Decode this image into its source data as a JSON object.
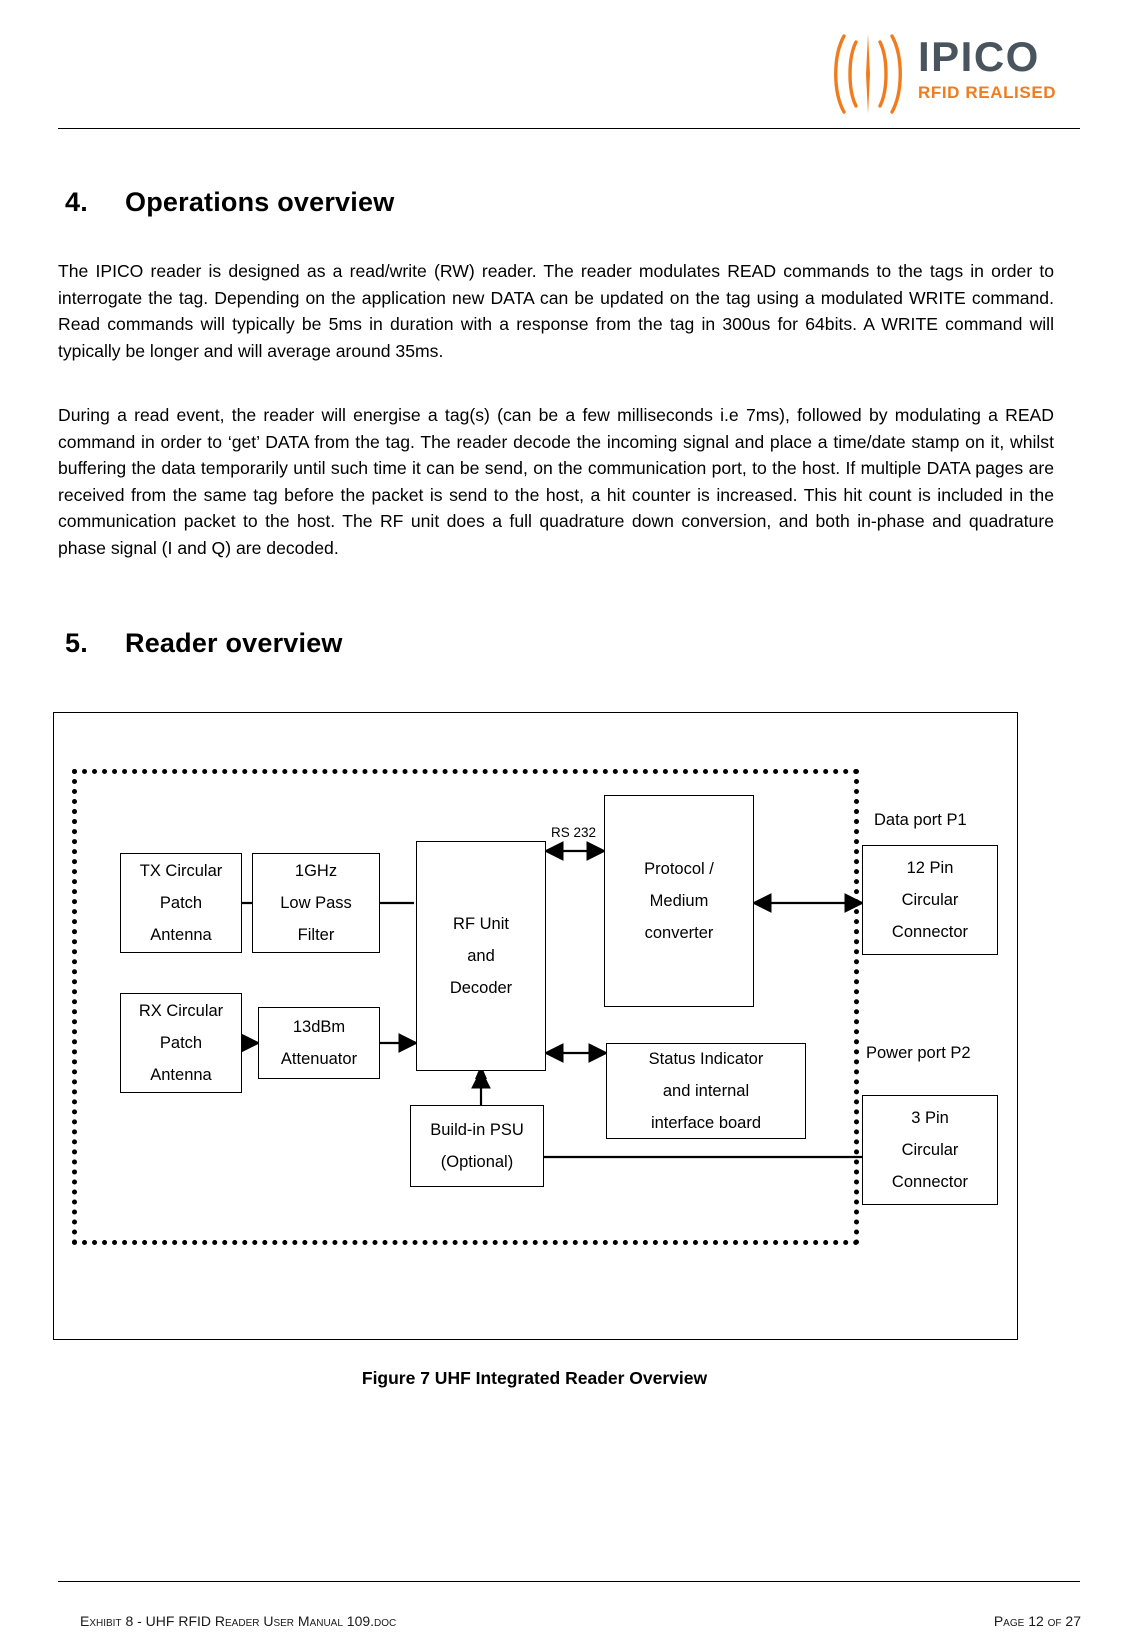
{
  "header": {
    "logo": {
      "wordmark": "IPICO",
      "tagline": "RFID REALISED",
      "mark_icon": "rfid-wave-icon",
      "wordmark_color": "#4a545e",
      "tagline_color": "#f07c1e"
    }
  },
  "sections": [
    {
      "number": "4.",
      "title": "Operations overview",
      "paragraphs": [
        "The IPICO reader is designed as a read/write (RW) reader.  The reader modulates READ commands to the tags in order to interrogate the tag. Depending on the application new DATA can be updated on the tag using a modulated WRITE command. Read commands will typically be 5ms in duration with a response from the tag in 300us for 64bits. A WRITE command will typically be longer and will average around 35ms.",
        "During a read event, the reader will energise a tag(s) (can be a few milliseconds i.e 7ms), followed by modulating a READ command in order to ‘get’ DATA from the tag. The reader  decode the incoming signal and place a time/date stamp on it, whilst buffering the data temporarily until such time it can be send, on the communication port, to the host.  If multiple DATA pages are received from the same tag before the packet is send to the host, a hit counter is increased.  This hit count is included in the communication packet to the host.  The RF unit does a full quadrature down conversion, and both in-phase and quadrature phase signal (I and Q) are decoded."
      ]
    },
    {
      "number": "5.",
      "title": "Reader overview",
      "paragraphs": []
    }
  ],
  "figure": {
    "caption": "Figure 7 UHF Integrated Reader Overview",
    "blocks": {
      "tx_antenna": [
        "TX Circular",
        "Patch",
        "Antenna"
      ],
      "low_pass_filter": [
        "1GHz",
        "Low Pass",
        "Filter"
      ],
      "rx_antenna": [
        "RX Circular",
        "Patch",
        "Antenna"
      ],
      "attenuator": [
        "13dBm",
        "Attenuator"
      ],
      "rf_unit": [
        "RF Unit",
        "and",
        "Decoder"
      ],
      "protocol_converter": [
        "Protocol /",
        "Medium",
        "converter"
      ],
      "status_indicator": [
        "Status Indicator",
        "and internal",
        "interface board"
      ],
      "psu": [
        "Build-in PSU",
        "(Optional)"
      ],
      "data_connector": [
        "12 Pin",
        "Circular",
        "Connector"
      ],
      "power_connector": [
        "3 Pin",
        "Circular",
        "Connector"
      ]
    },
    "labels": {
      "rs232": "RS 232",
      "data_port": "Data port P1",
      "power_port": "Power port P2"
    }
  },
  "footer": {
    "left": "Exhibit 8 - UHF RFID Reader User Manual 109.doc",
    "right": "Page 12 of 27"
  }
}
